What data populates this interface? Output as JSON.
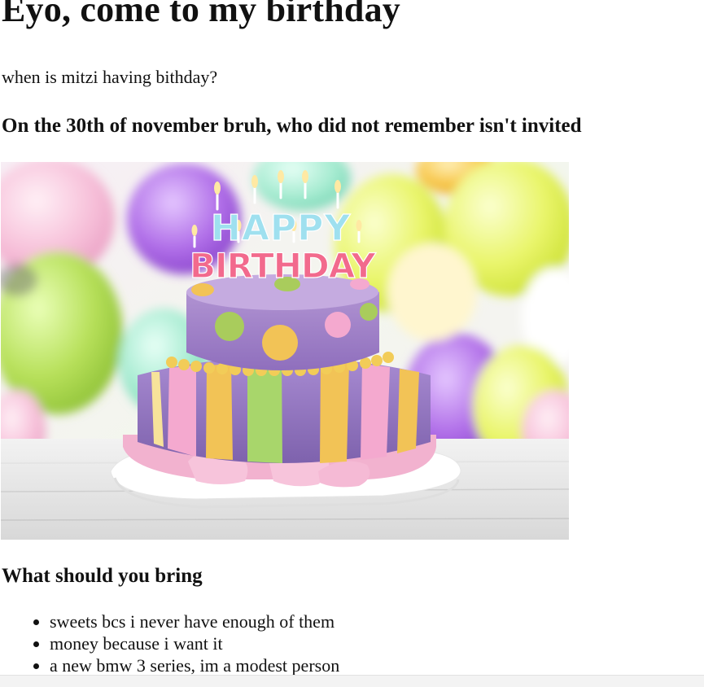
{
  "page": {
    "heading": "Eyo, come to my birthday",
    "question": "when is mitzi having bithday?",
    "answer": "On the 30th of november bruh, who did not remember isn't invited",
    "image": {
      "cake_text_line1": "HAPPY",
      "cake_text_line2": "BIRTHDAY"
    },
    "bring_title": "What should you bring",
    "bring_items": [
      "sweets bcs i never have enough of them",
      "money because i want it",
      "a new bmw 3 series, im a modest person"
    ]
  },
  "colors": {
    "text": "#111111",
    "background": "#ffffff"
  }
}
